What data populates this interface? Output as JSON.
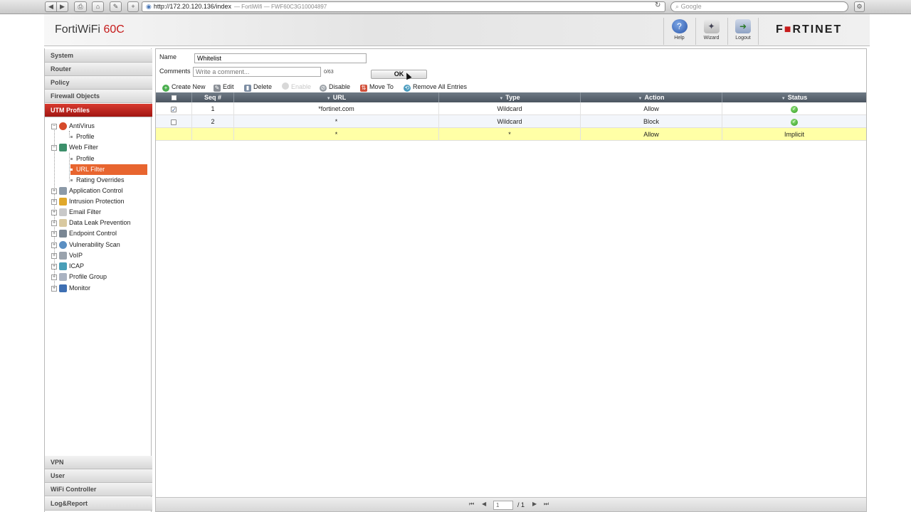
{
  "browser": {
    "url": "http://172.20.120.136/index",
    "page_title": "— FortiWifi — FWF60C3G10004897",
    "search_placeholder": "Google",
    "back": "◀",
    "forward": "▶",
    "print": "⎙",
    "home": "⌂",
    "bookmarks": "✎",
    "add": "+",
    "reload": "↻",
    "settings": "⚙",
    "globe": "◉",
    "search_icon_glyph": "⌕"
  },
  "header": {
    "product": "FortiWiFi",
    "model": "60C",
    "tools": [
      {
        "label": "Help",
        "icon": "?"
      },
      {
        "label": "Wizard",
        "icon": "✦"
      },
      {
        "label": "Logout",
        "icon": "➜"
      }
    ],
    "brand_part1": "F",
    "brand_mark": "■",
    "brand_part2": "RTINET"
  },
  "sidebar": {
    "sections_top": [
      "System",
      "Router",
      "Policy",
      "Firewall Objects",
      "UTM Profiles"
    ],
    "active_section": "UTM Profiles",
    "tree": {
      "antivirus": "AntiVirus",
      "antivirus_profile": "Profile",
      "web_filter": "Web Filter",
      "web_filter_profile": "Profile",
      "url_filter": "URL Filter",
      "rating_overrides": "Rating Overrides",
      "application_control": "Application Control",
      "intrusion_protection": "Intrusion Protection",
      "email_filter": "Email Filter",
      "data_leak_prevention": "Data Leak Prevention",
      "endpoint_control": "Endpoint Control",
      "vulnerability_scan": "Vulnerability Scan",
      "voip": "VoIP",
      "icap": "ICAP",
      "profile_group": "Profile Group",
      "monitor": "Monitor"
    },
    "sections_bottom": [
      "VPN",
      "User",
      "WiFi Controller",
      "Log&Report"
    ],
    "expand_minus": "−",
    "expand_plus": "+"
  },
  "form": {
    "name_label": "Name",
    "name_value": "Whitelist",
    "comments_label": "Comments",
    "comments_placeholder": "Write a comment...",
    "comment_counter": "0/63",
    "ok_label": "OK"
  },
  "toolbar": {
    "create_new": "Create New",
    "edit": "Edit",
    "delete": "Delete",
    "enable": "Enable",
    "disable": "Disable",
    "move_to": "Move To",
    "remove_all": "Remove All Entries"
  },
  "table": {
    "columns": [
      "Seq #",
      "URL",
      "Type",
      "Action",
      "Status"
    ],
    "filter_glyph": "▼",
    "rows": [
      {
        "checked": true,
        "seq": "1",
        "url": "*fortinet.com",
        "type": "Wildcard",
        "action": "Allow",
        "status": "ok"
      },
      {
        "checked": false,
        "seq": "2",
        "url": "*",
        "type": "Wildcard",
        "action": "Block",
        "status": "ok"
      },
      {
        "checked": null,
        "seq": "",
        "url": "*",
        "type": "*",
        "action": "Allow",
        "status": "Implicit"
      }
    ],
    "check_glyph": "✓",
    "ok_glyph": "✓"
  },
  "pager": {
    "first": "⏮",
    "prev": "◀",
    "page_value": "1",
    "total": "/ 1",
    "next": "▶",
    "last": "⏭"
  },
  "colors": {
    "active_section": "#b9201a",
    "selected_tree_item": "#e8652f",
    "implicit_row": "#ffffa6",
    "table_header": "#56606b"
  }
}
